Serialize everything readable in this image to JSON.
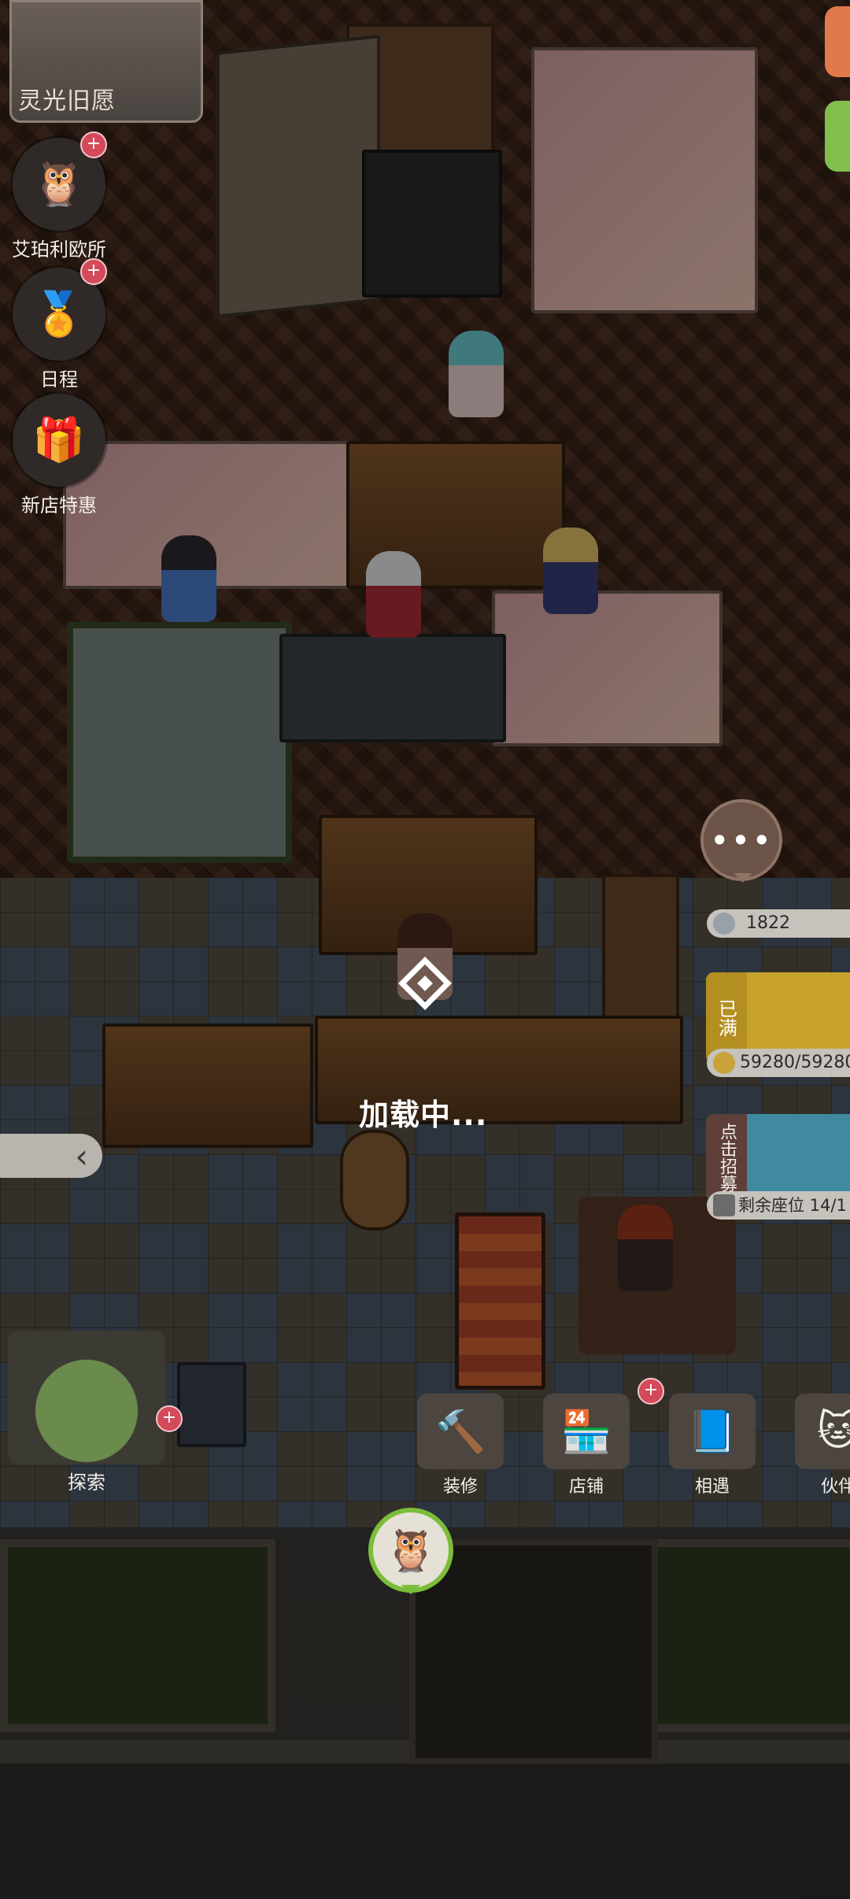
{
  "banner": {
    "title": "灵光旧愿"
  },
  "side_menu": [
    {
      "label": "艾珀利欧所",
      "icon": "owl-icon",
      "has_badge": true
    },
    {
      "label": "日程",
      "icon": "schedule-badge-icon",
      "has_badge": true
    },
    {
      "label": "新店特惠",
      "icon": "gift-box-icon",
      "has_badge": false
    }
  ],
  "badge_symbol": "+",
  "more_button": {
    "label": "•••"
  },
  "stats": {
    "top_value": "1822",
    "full_tag": "已满",
    "capacity": "59280/59280",
    "recruit_tag": "点击招募",
    "seats": "剩余座位 14/1"
  },
  "loading": {
    "text": "加载中..."
  },
  "left_arrow": {
    "label": "‹"
  },
  "explore": {
    "label": "探索"
  },
  "bottom_bar": [
    {
      "label": "装修",
      "icon": "hammer-icon"
    },
    {
      "label": "店铺",
      "icon": "shop-icon"
    },
    {
      "label": "相遇",
      "icon": "encounter-icon"
    },
    {
      "label": "伙伴",
      "icon": "cat-partner-icon"
    }
  ],
  "colors": {
    "badge_red": "#d44a5a",
    "full_yellow": "#c7a32b",
    "npc_ring_green": "#7bbd3a",
    "overlay_dim": "rgba(0,0,0,0.42)"
  }
}
